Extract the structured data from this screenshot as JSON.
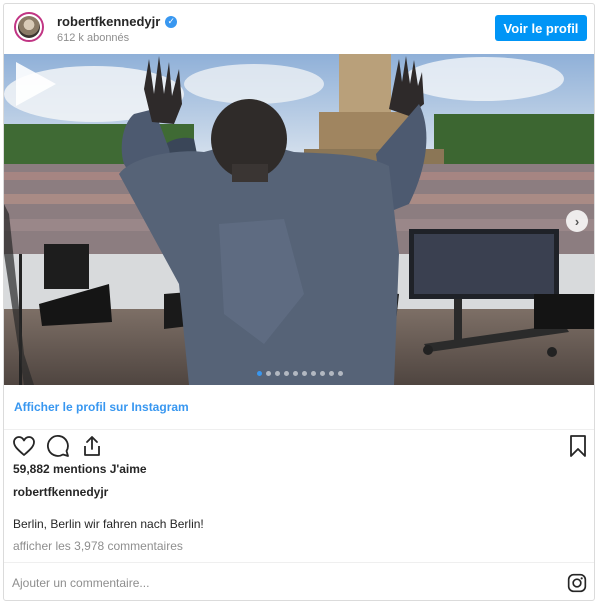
{
  "header": {
    "username": "robertfkennedyjr",
    "followers": "612 k abonnés",
    "view_profile_label": "Voir le profil"
  },
  "media": {
    "type": "video",
    "carousel_dots": 10,
    "active_dot": 0
  },
  "links": {
    "view_on_instagram": "Afficher le profil sur Instagram"
  },
  "post": {
    "likes": "59,882 mentions J'aime",
    "username": "robertfkennedyjr",
    "caption": "Berlin, Berlin wir fahren nach Berlin!",
    "comments_link": "afficher les 3,978 commentaires"
  },
  "comment_box": {
    "placeholder": "Ajouter un commentaire..."
  },
  "colors": {
    "accent": "#0095f6",
    "link": "#3897f0",
    "verified": "#3897f0"
  },
  "icons": [
    "heart-icon",
    "comment-icon",
    "share-icon",
    "bookmark-icon",
    "instagram-icon",
    "verified-badge-icon",
    "play-icon",
    "chevron-right-icon"
  ]
}
